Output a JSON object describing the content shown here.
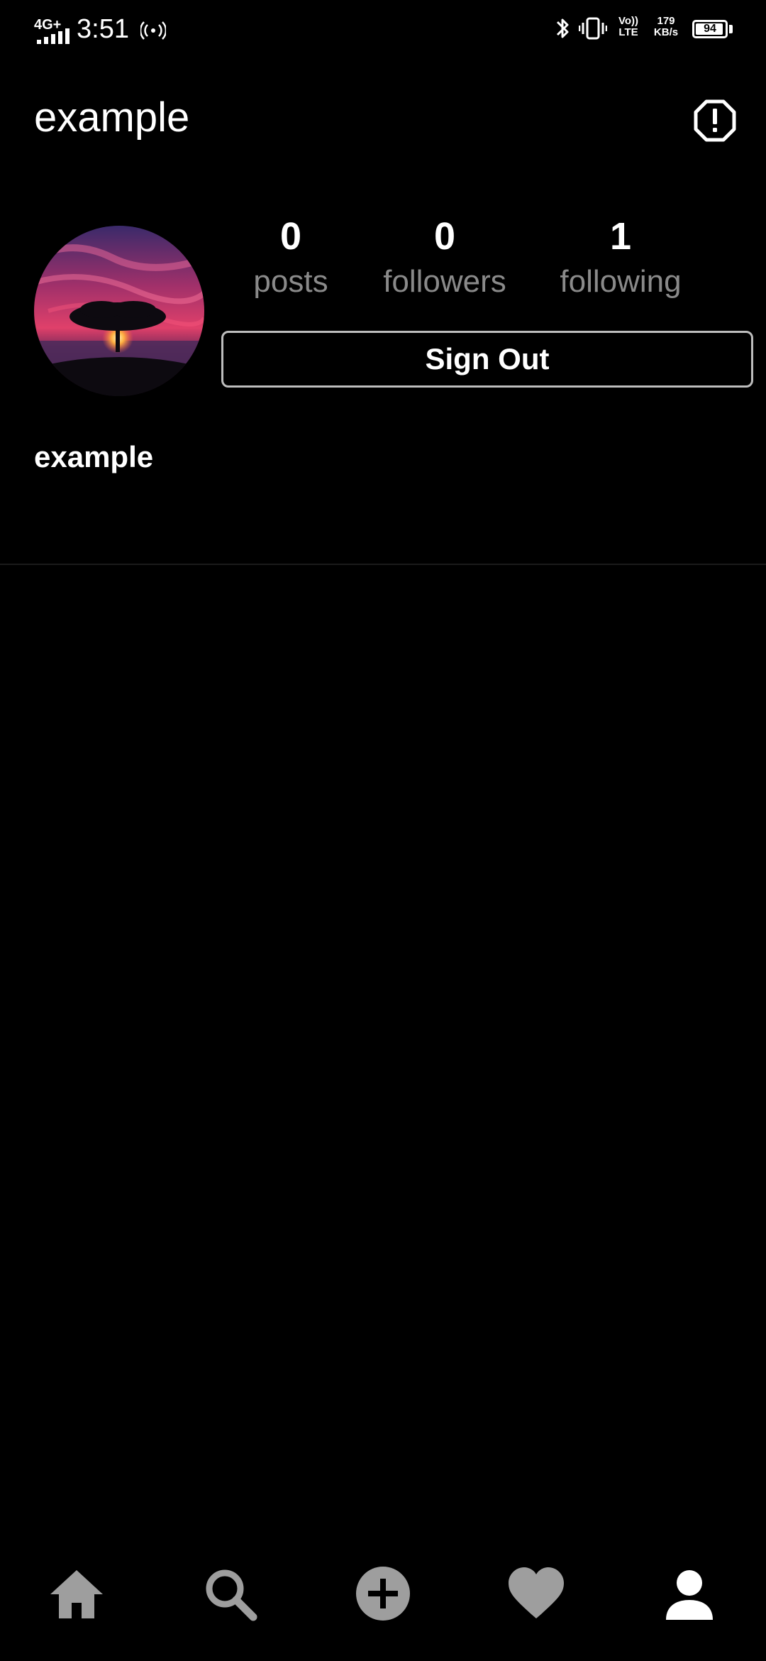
{
  "status_bar": {
    "network": "4G+",
    "time": "3:51",
    "volte_line1": "Vo))",
    "volte_line2": "LTE",
    "speed_value": "179",
    "speed_unit": "KB/s",
    "battery_level": "94"
  },
  "header": {
    "title": "example",
    "report_icon": "alert-octagon-icon"
  },
  "profile": {
    "stats": [
      {
        "value": "0",
        "label": "posts"
      },
      {
        "value": "0",
        "label": "followers"
      },
      {
        "value": "1",
        "label": "following"
      }
    ],
    "sign_out_label": "Sign Out",
    "username": "example"
  },
  "bottom_nav": {
    "items": [
      "home-icon",
      "search-icon",
      "add-icon",
      "heart-icon",
      "profile-icon"
    ],
    "active": "profile-icon"
  },
  "colors": {
    "background": "#000000",
    "text": "#ffffff",
    "muted": "#8a8a8a",
    "nav_inactive": "#9e9e9e",
    "nav_active": "#ffffff"
  }
}
